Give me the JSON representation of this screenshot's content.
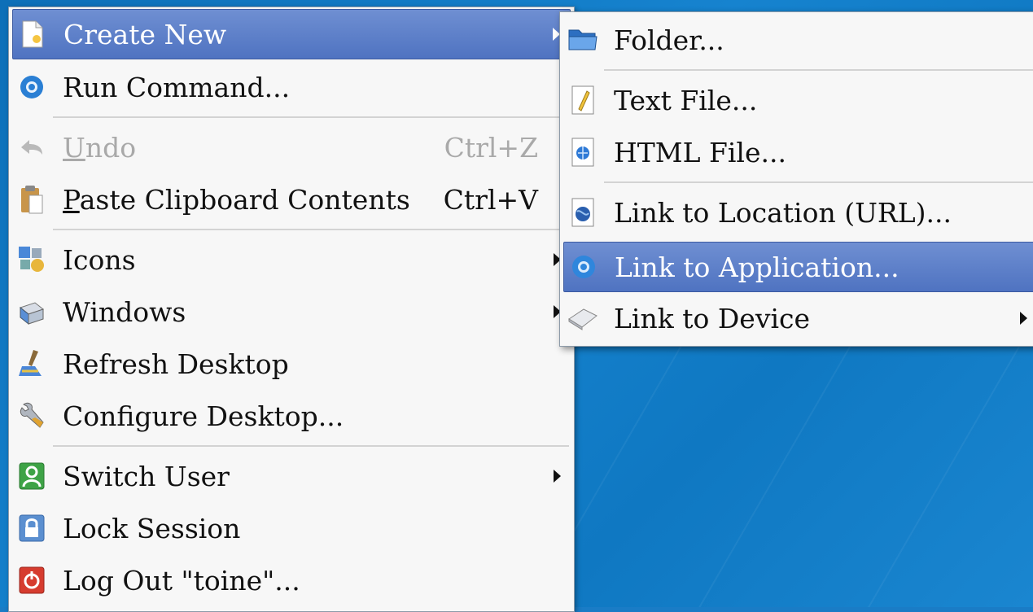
{
  "menu": {
    "create_new": "Create New",
    "run_command": "Run Command...",
    "undo": "Undo",
    "undo_shortcut": "Ctrl+Z",
    "paste": "Paste Clipboard Contents",
    "paste_shortcut": "Ctrl+V",
    "icons": "Icons",
    "windows": "Windows",
    "refresh": "Refresh Desktop",
    "configure": "Configure Desktop...",
    "switch_user": "Switch User",
    "lock": "Lock Session",
    "logout": "Log Out \"toine\"..."
  },
  "submenu": {
    "folder": "Folder...",
    "text_file": "Text File...",
    "html_file": "HTML File...",
    "link_url": "Link to Location (URL)...",
    "link_app": "Link to Application...",
    "link_device": "Link to Device"
  },
  "colors": {
    "highlight": "#5a7cc8",
    "desktop": "#1a7cc6",
    "menu_bg": "#f7f7f7"
  }
}
